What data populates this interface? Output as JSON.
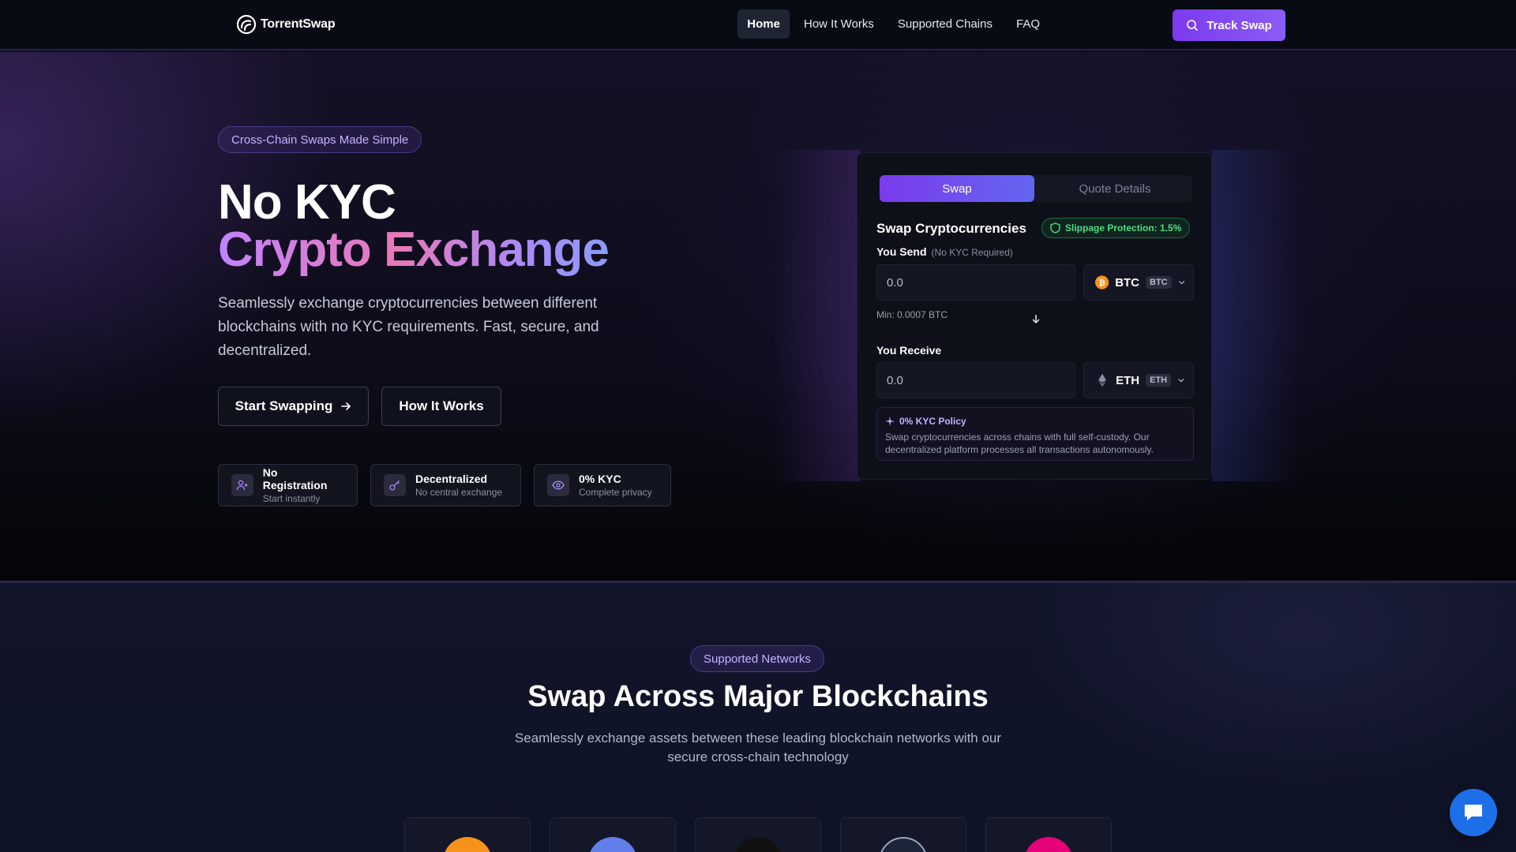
{
  "nav": {
    "brand": "TorrentSwap",
    "links": [
      "Home",
      "How It Works",
      "Supported Chains",
      "FAQ"
    ],
    "track_label": "Track Swap"
  },
  "hero": {
    "badge": "Cross-Chain Swaps Made Simple",
    "title_line1": "No KYC",
    "title_line2": "Crypto Exchange",
    "description": "Seamlessly exchange cryptocurrencies between different blockchains with no KYC requirements. Fast, secure, and decentralized.",
    "start_label": "Start Swapping",
    "how_label": "How It Works",
    "features": [
      {
        "title": "No Registration",
        "subtitle": "Start instantly",
        "icon": "user-plus-icon"
      },
      {
        "title": "Decentralized",
        "subtitle": "No central exchange",
        "icon": "key-icon"
      },
      {
        "title": "0% KYC",
        "subtitle": "Complete privacy",
        "icon": "eye-icon"
      }
    ]
  },
  "swap": {
    "tab_swap": "Swap",
    "tab_quote": "Quote Details",
    "heading": "Swap Cryptocurrencies",
    "slippage": "Slippage Protection: 1.5%",
    "send_label": "You Send",
    "send_note": "(No KYC Required)",
    "send_value": "0.0",
    "send_token": "BTC",
    "send_symbol": "BTC",
    "min_note": "Min: 0.0007 BTC",
    "receive_label": "You Receive",
    "receive_value": "0.0",
    "receive_token": "ETH",
    "receive_symbol": "ETH",
    "kyc_title": "0% KYC Policy",
    "kyc_text": "Swap cryptocurrencies across chains with full self-custody. Our decentralized platform processes all transactions autonomously."
  },
  "networks": {
    "badge": "Supported Networks",
    "title": "Swap Across Major Blockchains",
    "description": "Seamlessly exchange assets between these leading blockchain networks with our secure cross-chain technology",
    "chains": [
      {
        "icon": "bitcoin-icon",
        "color": "#f7931a"
      },
      {
        "icon": "ethereum-icon",
        "color": "#627eea"
      },
      {
        "icon": "solana-icon",
        "color": "#111111"
      },
      {
        "icon": "hyperliquid-icon",
        "color": "#1c2438"
      },
      {
        "icon": "polkadot-icon",
        "color": "#e6007a"
      }
    ]
  },
  "colors": {
    "accent": "#7c3aed",
    "success": "#4ade80",
    "chat": "#1d6fe8"
  }
}
